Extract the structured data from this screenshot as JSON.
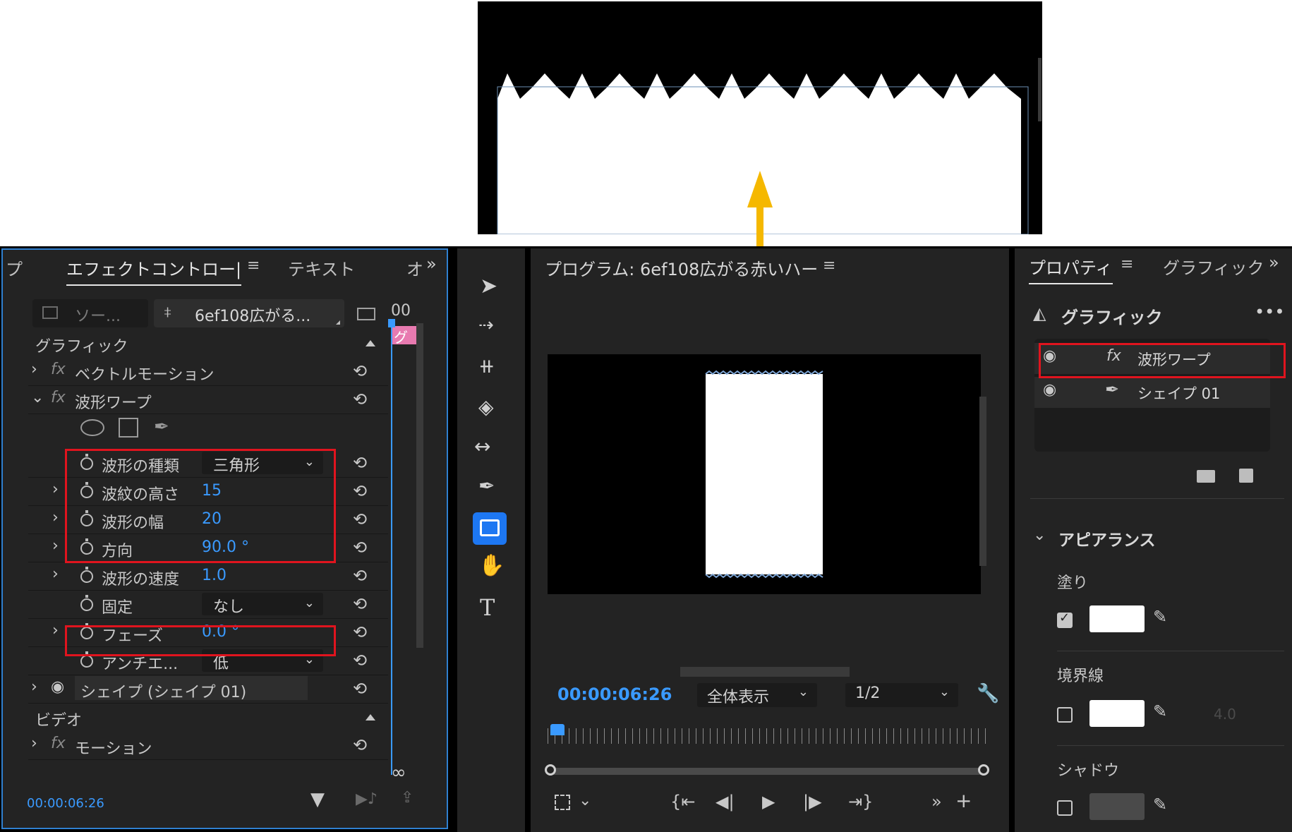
{
  "effect_controls": {
    "tabs": [
      "プ",
      "エフェクトコントロー|",
      "テキスト",
      "オ"
    ],
    "active_tab": "エフェクトコントロー|",
    "source_label": "ソー...",
    "clip_label": "6ef108広がる...",
    "timecode_ruler": "00",
    "clip_strip_label": "グ",
    "sections": {
      "graphic": "グラフィック",
      "video": "ビデオ"
    },
    "rows": {
      "vector_motion": "ベクトルモーション",
      "wave_warp": "波形ワープ",
      "wave_type": {
        "label": "波形の種類",
        "value": "三角形"
      },
      "wave_height": {
        "label": "波紋の高さ",
        "value": "15"
      },
      "wave_width": {
        "label": "波形の幅",
        "value": "20"
      },
      "direction": {
        "label": "方向",
        "value": "90.0 °"
      },
      "wave_speed": {
        "label": "波形の速度",
        "value": "1.0"
      },
      "pinning": {
        "label": "固定",
        "value": "なし"
      },
      "phase": {
        "label": "フェーズ",
        "value": "0.0 °"
      },
      "antialias": {
        "label": "アンチエ...",
        "value": "低"
      },
      "shape": "シェイプ (シェイプ 01)",
      "motion": "モーション"
    },
    "footer_timecode": "00:00:06:26"
  },
  "program_monitor": {
    "title": "プログラム: 6ef108広がる赤いハー",
    "timecode": "00:00:06:26",
    "zoom_select": "全体表示",
    "resolution_select": "1/2"
  },
  "properties": {
    "tabs": [
      "プロパティ",
      "グラフィック"
    ],
    "header": "グラフィック",
    "layers": [
      {
        "name": "波形ワープ",
        "type": "fx"
      },
      {
        "name": "シェイプ 01",
        "type": "shape"
      }
    ],
    "appearance": {
      "title": "アピアランス",
      "fill_label": "塗り",
      "stroke_label": "境界線",
      "stroke_width": "4.0",
      "shadow_label": "シャドウ",
      "fill_color": "#ffffff",
      "stroke_color": "#ffffff",
      "shadow_color": "#4a4a4a"
    }
  },
  "colors": {
    "accent_blue": "#3a9aff",
    "highlight_red": "#e0141e",
    "arrow_yellow": "#f5b800",
    "panel_bg": "#232323"
  }
}
